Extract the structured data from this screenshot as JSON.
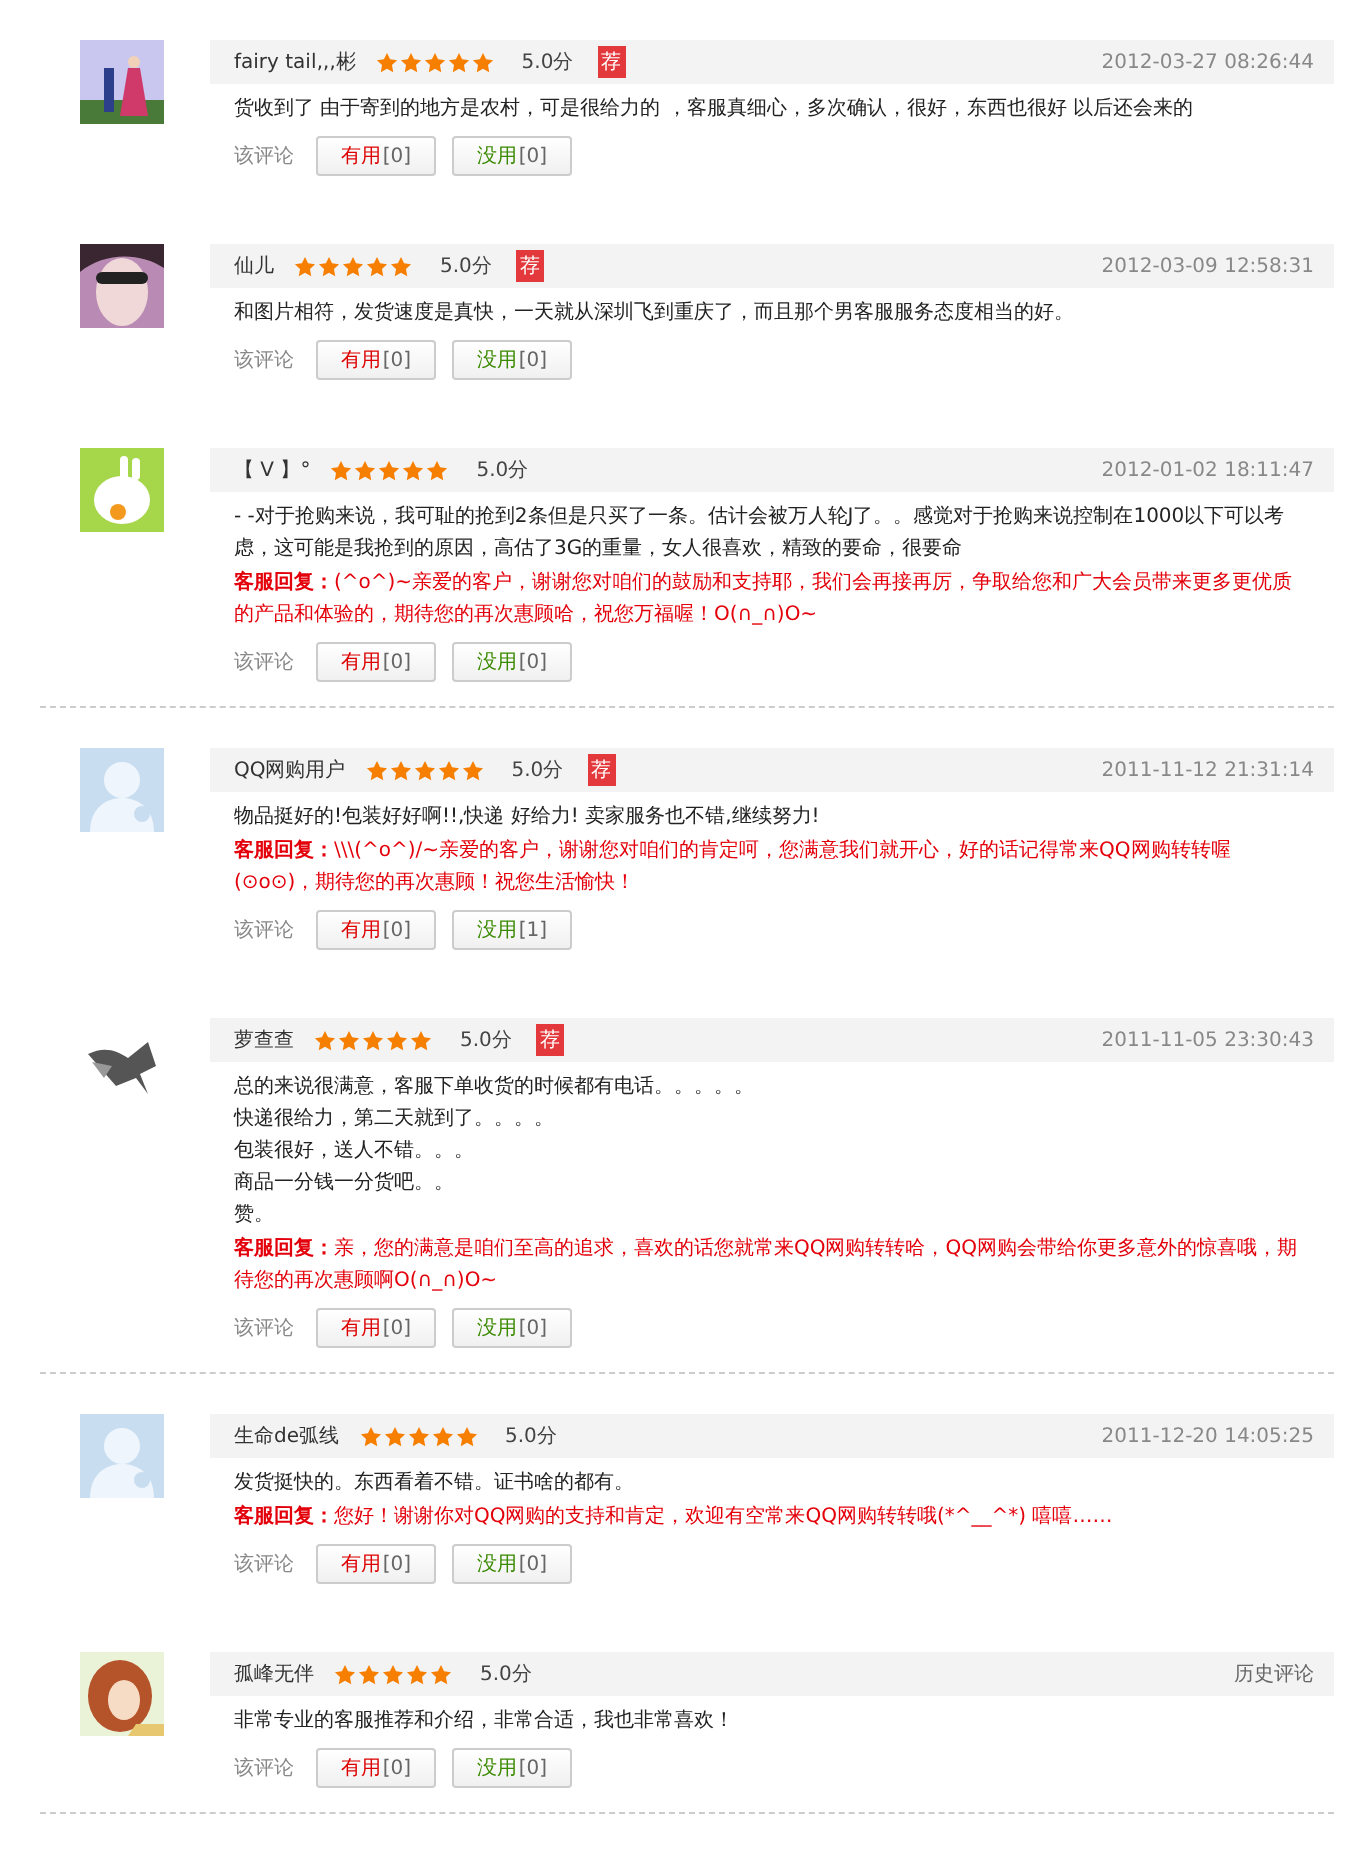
{
  "reviews": [
    {
      "user": "fairy tail‚‚‚彬",
      "stars": 5,
      "score": "5.0分",
      "badge": "荐",
      "time": "2012-03-27 08:26:44",
      "text": [
        "货收到了 由于寄到的地方是农村，可是很给力的 ，客服真细心，多次确认，很好，东西也很好 以后还会来的"
      ],
      "vote_label": "该评论",
      "useful": {
        "label": "有用",
        "count": "[0]"
      },
      "useless": {
        "label": "没用",
        "count": "[0]"
      },
      "divider": false
    },
    {
      "user": "仙儿",
      "stars": 5,
      "score": "5.0分",
      "badge": "荐",
      "time": "2012-03-09 12:58:31",
      "text": [
        "和图片相符，发货速度是真快，一天就从深圳飞到重庆了，而且那个男客服服务态度相当的好。"
      ],
      "vote_label": "该评论",
      "useful": {
        "label": "有用",
        "count": "[0]"
      },
      "useless": {
        "label": "没用",
        "count": "[0]"
      },
      "divider": false
    },
    {
      "user": "【 V 】°",
      "stars": 5,
      "score": "5.0分",
      "time": "2012-01-02 18:11:47",
      "text": [
        "- -对于抢购来说，我可耻的抢到2条但是只买了一条。估计会被万人轮J了。。感觉对于抢购来说控制在1000以下可以考虑，这可能是我抢到的原因，高估了3G的重量，女人很喜欢，精致的要命，很要命"
      ],
      "reply": {
        "label": "客服回复：",
        "text": "(^o^)~亲爱的客户，谢谢您对咱们的鼓励和支持耶，我们会再接再厉，争取给您和广大会员带来更多更优质的产品和体验的，期待您的再次惠顾哈，祝您万福喔！O(∩_∩)O~"
      },
      "vote_label": "该评论",
      "useful": {
        "label": "有用",
        "count": "[0]"
      },
      "useless": {
        "label": "没用",
        "count": "[0]"
      },
      "divider": true
    },
    {
      "avatar": {
        "kind": "default"
      },
      "user": "QQ网购用户",
      "stars": 5,
      "score": "5.0分",
      "badge": "荐",
      "time": "2011-11-12 21:31:14",
      "text": [
        "物品挺好的!包装好好啊!!,快递 好给力! 卖家服务也不错,继续努力!"
      ],
      "reply": {
        "label": "客服回复：",
        "text": "\\\\\\(^o^)/~亲爱的客户，谢谢您对咱们的肯定呵，您满意我们就开心，好的话记得常来QQ网购转转喔(⊙o⊙)，期待您的再次惠顾！祝您生活愉快！"
      },
      "vote_label": "该评论",
      "useful": {
        "label": "有用",
        "count": "[0]"
      },
      "useless": {
        "label": "没用",
        "count": "[1]"
      },
      "divider": false
    },
    {
      "user": "萝查查",
      "stars": 5,
      "score": "5.0分",
      "badge": "荐",
      "time": "2011-11-05 23:30:43",
      "text": [
        "总的来说很满意，客服下单收货的时候都有电话。。。。。",
        "快递很给力，第二天就到了。。。。",
        "包装很好，送人不错。。。",
        "商品一分钱一分货吧。。",
        "赞。"
      ],
      "reply": {
        "label": "客服回复：",
        "text": "亲，您的满意是咱们至高的追求，喜欢的话您就常来QQ网购转转哈，QQ网购会带给你更多意外的惊喜哦，期待您的再次惠顾啊O(∩_∩)O~"
      },
      "vote_label": "该评论",
      "useful": {
        "label": "有用",
        "count": "[0]"
      },
      "useless": {
        "label": "没用",
        "count": "[0]"
      },
      "divider": true
    },
    {
      "avatar": {
        "kind": "default"
      },
      "user": "生命de弧线",
      "stars": 5,
      "score": "5.0分",
      "time": "2011-12-20 14:05:25",
      "text": [
        "发货挺快的。东西看着不错。证书啥的都有。"
      ],
      "reply": {
        "label": "客服回复：",
        "text": "您好！谢谢你对QQ网购的支持和肯定，欢迎有空常来QQ网购转转哦(*^__^*) 嘻嘻……"
      },
      "vote_label": "该评论",
      "useful": {
        "label": "有用",
        "count": "[0]"
      },
      "useless": {
        "label": "没用",
        "count": "[0]"
      },
      "divider": false
    },
    {
      "user": "孤峰无伴",
      "stars": 5,
      "score": "5.0分",
      "history": "历史评论",
      "text": [
        "非常专业的客服推荐和介绍，非常合适，我也非常喜欢！"
      ],
      "vote_label": "该评论",
      "useful": {
        "label": "有用",
        "count": "[0]"
      },
      "useless": {
        "label": "没用",
        "count": "[0]"
      },
      "divider": true
    }
  ]
}
